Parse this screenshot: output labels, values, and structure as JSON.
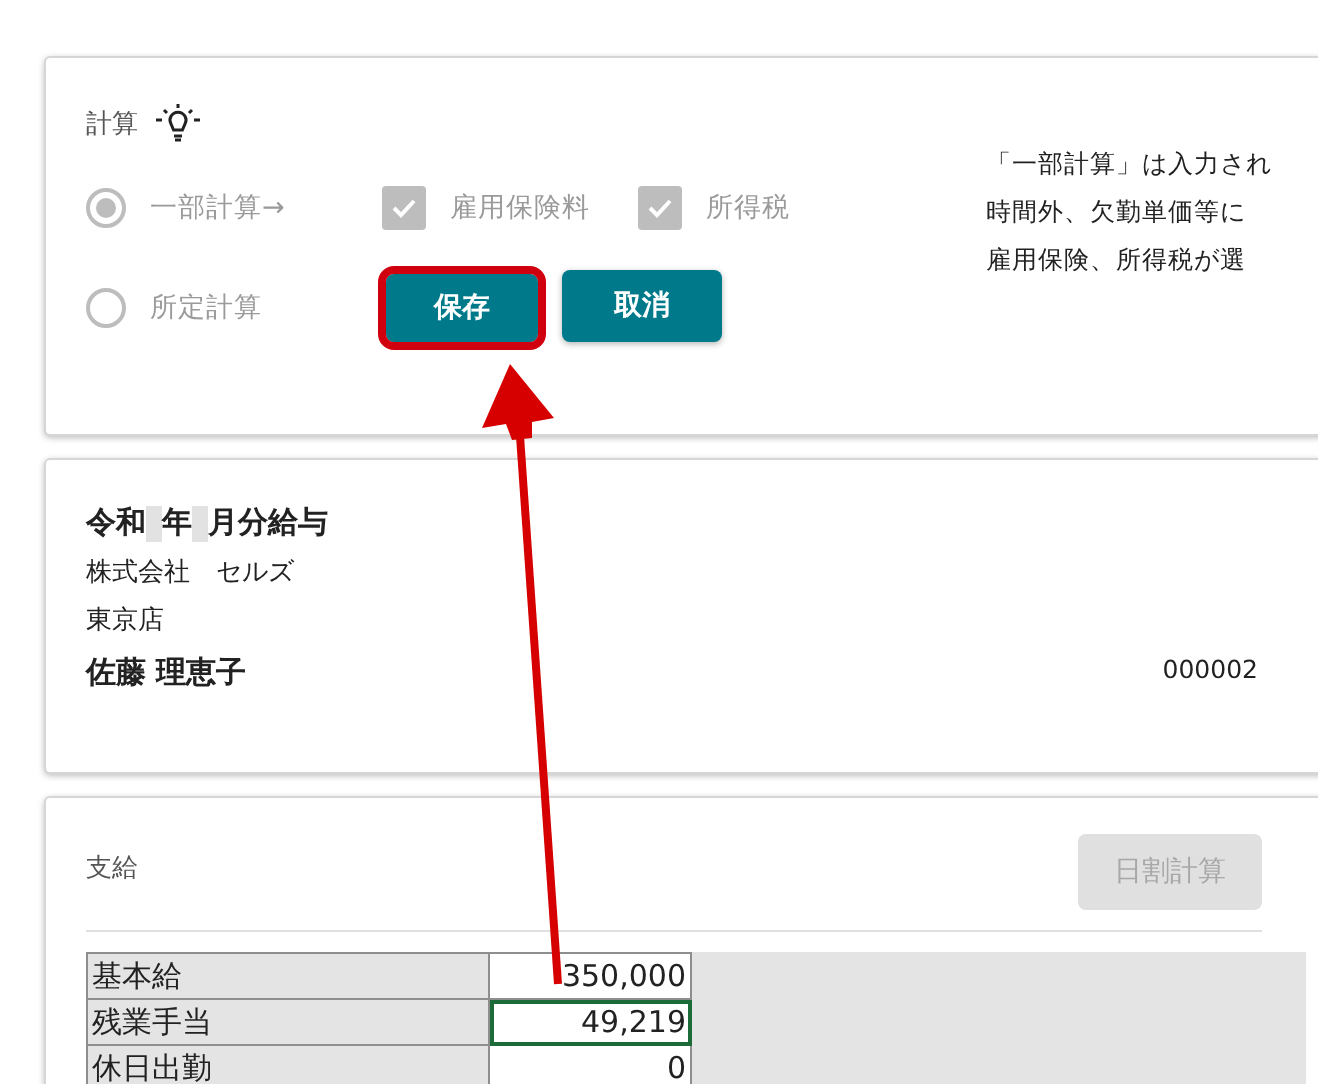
{
  "calc_card": {
    "title": "計算",
    "modes": [
      {
        "label": "一部計算→",
        "selected": true,
        "disabled": true
      },
      {
        "label": "所定計算",
        "selected": false,
        "disabled": true
      }
    ],
    "options": [
      {
        "label": "雇用保険料",
        "checked": true,
        "disabled": true
      },
      {
        "label": "所得税",
        "checked": true,
        "disabled": true
      }
    ],
    "buttons": [
      {
        "label": "保存",
        "highlighted": true
      },
      {
        "label": "取消",
        "highlighted": false
      }
    ],
    "notes": [
      "「一部計算」は入力され",
      "時間外、欠勤単価等に",
      "雇用保険、所得税が選"
    ]
  },
  "payslip": {
    "heading": [
      "令和",
      "年",
      "月分給与"
    ],
    "company": "株式会社　セルズ",
    "branch": "東京店",
    "employee": "佐藤 理恵子",
    "employee_no": "000002"
  },
  "earnings": {
    "title": "支給",
    "prorate_button": {
      "label": "日割計算",
      "disabled": true
    },
    "rows": [
      {
        "label": "基本給",
        "value": "350,000",
        "selected": false
      },
      {
        "label": "残業手当",
        "value": "49,219",
        "selected": true
      },
      {
        "label": "休日出勤",
        "value": "0",
        "selected": false
      }
    ]
  }
}
